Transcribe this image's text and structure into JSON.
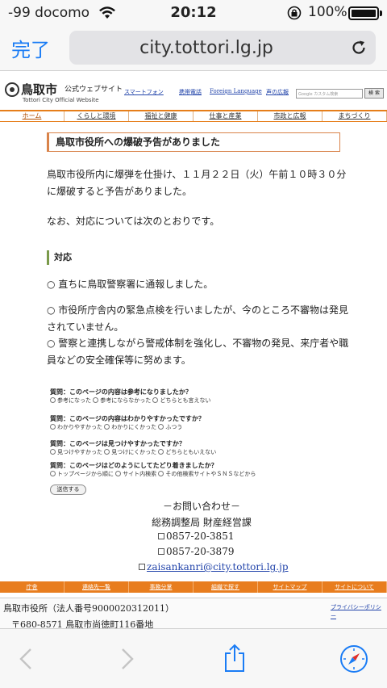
{
  "status_bar": {
    "carrier": "-99 docomo",
    "time": "20:12",
    "battery_pct": "100%",
    "battery_level": 100
  },
  "browser": {
    "done_label": "完了",
    "url": "city.tottori.lg.jp"
  },
  "site": {
    "logo_name": "鳥取市",
    "logo_sub": "公式ウェブサイト",
    "logo_en": "Tottori City Official Website",
    "util_links": [
      "スマートフォン",
      "携帯電話",
      "Foreign Language",
      "声の広報"
    ],
    "search_placeholder": "Google カスタム検索",
    "search_button": "検 索",
    "nav": [
      "ホーム",
      "くらしと環境",
      "福祉と健康",
      "仕事と産業",
      "市政と広報",
      "まちづくり"
    ]
  },
  "article": {
    "title": "鳥取市役所への爆破予告がありました",
    "para1": "鳥取市役所内に爆弾を仕掛け、１１月２２日（火）午前１０時３０分に爆破すると予告がありました。",
    "para2": "なお、対応については次のとおりです。",
    "section_heading": "対応",
    "items": [
      "○ 直ちに鳥取警察署に通報しました。",
      "○ 市役所庁舎内の緊急点検を行いましたが、今のところ不審物は発見されていません。",
      "○ 警察と連携しながら警戒体制を強化し、不審物の発見、来庁者や職員などの安全確保等に努めます。"
    ]
  },
  "survey": {
    "q1": "質問：このページの内容は参考になりましたか？",
    "q1_opts": [
      "参考になった",
      "参考にならなかった",
      "どちらとも言えない"
    ],
    "q2": "質問：このページの内容はわかりやすかったですか？",
    "q2_opts": [
      "わかりやすかった",
      "わかりにくかった",
      "ふつう"
    ],
    "q3": "質問：このページは見つけやすかったですか？",
    "q3_opts": [
      "見つけやすかった",
      "見つけにくかった",
      "どちらともいえない"
    ],
    "q4": "質問：このページはどのようにしてたどり着きましたか？",
    "q4_opts": [
      "トップページから順に",
      "サイト内検索",
      "その他検索サイトやＳＮＳなどから"
    ],
    "submit": "送信する"
  },
  "contact": {
    "heading": "－お問い合わせ－",
    "dept": "総務調整局 財産経営課",
    "tel": "0857-20-3851",
    "fax": "0857-20-3879",
    "email": "zaisankanri@city.tottori.lg.jp"
  },
  "footer": {
    "nav": [
      "庁舎",
      "連絡先一覧",
      "事務分掌",
      "組織で探す",
      "サイトマップ",
      "サイトについて"
    ],
    "org": "鳥取市役所（法人番号9000020312011）",
    "address": "〒680-8571 鳥取市尚徳町116番地",
    "privacy": "プライバシーポリシー"
  }
}
